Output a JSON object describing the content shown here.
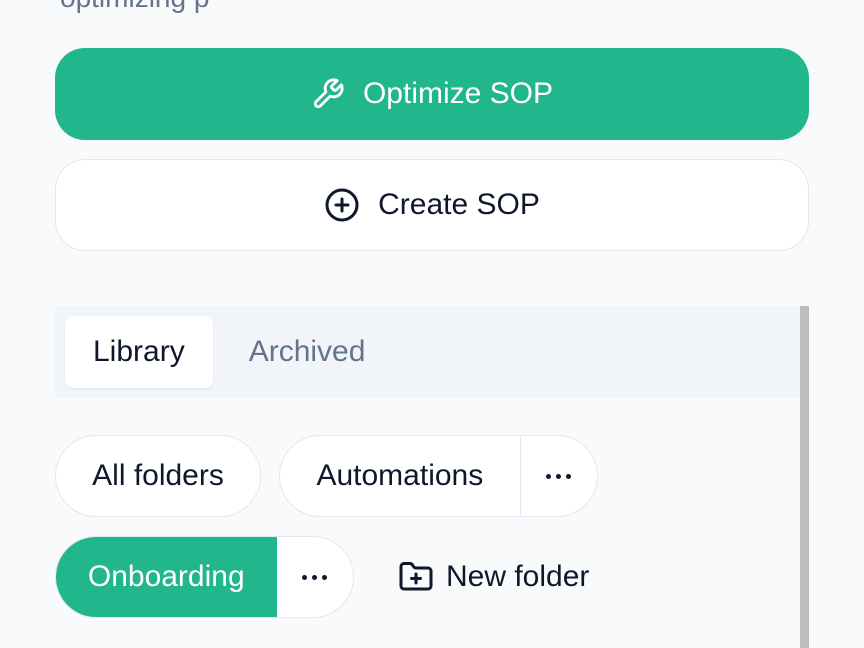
{
  "header": {
    "partial_text": "optimizing p"
  },
  "actions": {
    "optimize_label": "Optimize SOP",
    "create_label": "Create SOP"
  },
  "tabs": [
    {
      "label": "Library",
      "active": true
    },
    {
      "label": "Archived",
      "active": false
    }
  ],
  "folders": {
    "all_label": "All folders",
    "items": [
      {
        "label": "Automations",
        "selected": false
      },
      {
        "label": "Onboarding",
        "selected": true
      }
    ],
    "new_folder_label": "New folder"
  },
  "colors": {
    "accent": "#22b68c",
    "background": "#f8fafc",
    "text": "#0f172a",
    "muted": "#64748b",
    "border": "#e2e8f0"
  },
  "icons": {
    "optimize": "wrench-icon",
    "create": "plus-circle-icon",
    "more": "more-horizontal-icon",
    "new_folder": "folder-plus-icon"
  }
}
